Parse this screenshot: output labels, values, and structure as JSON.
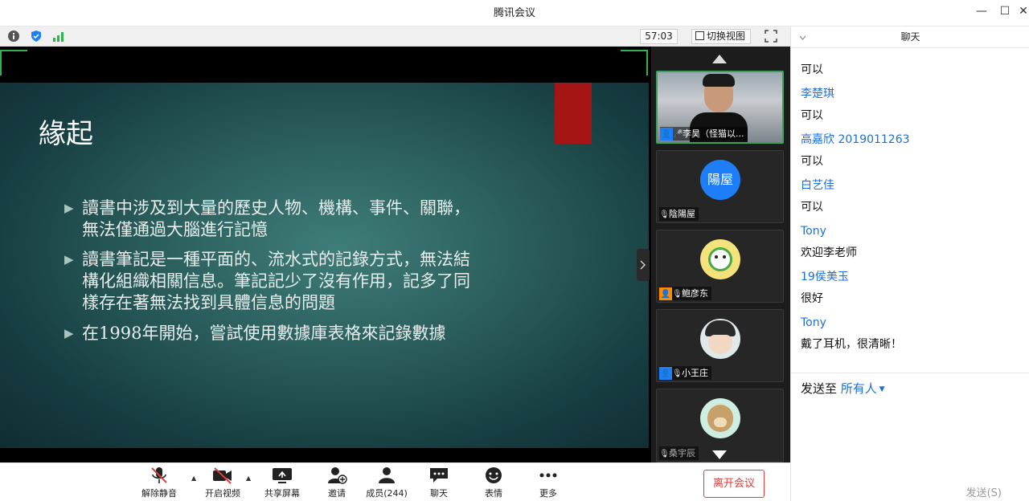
{
  "window": {
    "title": "腾讯会议",
    "minimize": "—",
    "maximize": "☐",
    "close": "✕"
  },
  "toolbar": {
    "timer": "57:03",
    "switch_view_label": "切换视图"
  },
  "slide": {
    "title": "緣起",
    "bullets": [
      [
        "讀書中涉及到大量的歷史人物、機構、事件、關聯，",
        "無法僅通過大腦進行記憶"
      ],
      [
        "讀書筆記是一種平面的、流水式的記錄方式，無法結",
        "構化組織相關信息。筆記記少了沒有作用，記多了同",
        "樣存在著無法找到具體信息的問題"
      ],
      [
        "在1998年開始，嘗試使用數據庫表格來記錄數據"
      ]
    ]
  },
  "participants": [
    {
      "name": "李昊（怪猫以..."
    },
    {
      "name": "陰陽屋",
      "avatar_text": "陽屋"
    },
    {
      "name": "鲍彦东"
    },
    {
      "name": "小王庄"
    },
    {
      "name": "桑宇辰"
    }
  ],
  "controls": {
    "mute": "解除静音",
    "video": "开启视频",
    "share": "共享屏幕",
    "invite": "邀请",
    "members": "成员(244)",
    "chat": "聊天",
    "emoji": "表情",
    "more": "更多",
    "leave": "离开会议"
  },
  "chat": {
    "title": "聊天",
    "messages": [
      {
        "name": "李楚琪",
        "text": "可以"
      },
      {
        "name": "高嘉欣 2019011263",
        "text": "可以"
      },
      {
        "name": "白艺佳",
        "text": "可以"
      },
      {
        "name": "Tony",
        "text": "欢迎李老师"
      },
      {
        "name": "19侯美玉",
        "text": "很好"
      },
      {
        "name": "Tony",
        "text": "戴了耳机，很清晰！"
      }
    ],
    "first_text": "可以",
    "send_to_label": "发送至",
    "send_to_value": "所有人",
    "send_button": "发送(S)"
  },
  "colors": {
    "accent_blue": "#1d6fd8",
    "leave_red": "#e53a3a",
    "active_green": "#3aa35a"
  }
}
